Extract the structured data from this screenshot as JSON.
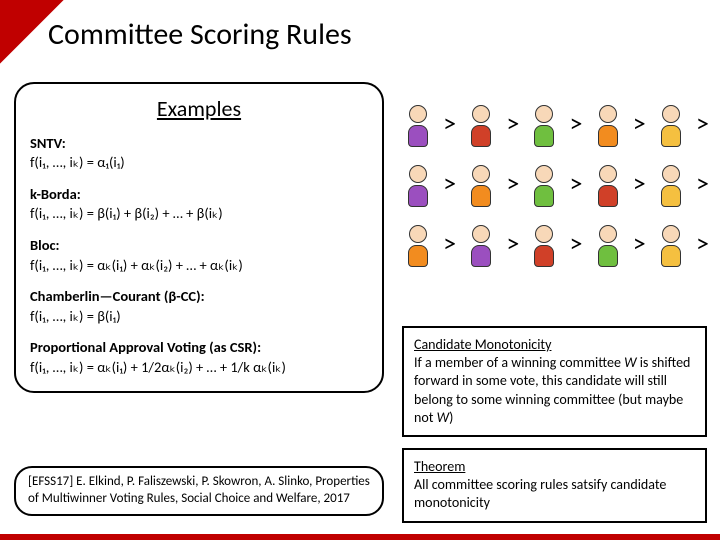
{
  "title": "Committee Scoring Rules",
  "examples": {
    "heading": "Examples",
    "sntv_label": "SNTV:",
    "sntv_formula": "f(i₁, …, iₖ) = α₁(i₁)",
    "kborda_label": "k-Borda:",
    "kborda_formula": "f(i₁, …, iₖ) = β(i₁) + β(i₂) + … + β(iₖ)",
    "bloc_label": "Bloc:",
    "bloc_formula": "f(i₁, …, iₖ) = αₖ(i₁) + αₖ(i₂) + … + αₖ(iₖ)",
    "cc_label": "Chamberlin—Courant (β-CC):",
    "cc_formula": "f(i₁, …, iₖ) = β(i₁)",
    "pav_label": "Proportional Approval Voting (as CSR):",
    "pav_formula": "f(i₁, …, iₖ) = αₖ(i₁) + 1/2αₖ(i₂) + … + 1/k αₖ(iₖ)"
  },
  "reference": "[EFSS17] E. Elkind, P. Faliszewski, P. Skowron, A. Slinko, Properties of Multiwinner Voting Rules, Social Choice and Welfare, 2017",
  "gt": ">",
  "prefs": {
    "rows": [
      [
        "purple",
        "red",
        "green",
        "orange",
        "yellow"
      ],
      [
        "purple",
        "orange",
        "green",
        "red",
        "yellow"
      ],
      [
        "orange",
        "purple",
        "red",
        "green",
        "yellow"
      ]
    ]
  },
  "mono": {
    "title": "Candidate Monotonicity",
    "text": "If a member of a winning committee W is shifted forward in some vote, this candidate will still belong to some winning committee (but maybe not W)"
  },
  "thm": {
    "title": "Theorem",
    "text": "All committee scoring rules satsify candidate monotonicity"
  }
}
